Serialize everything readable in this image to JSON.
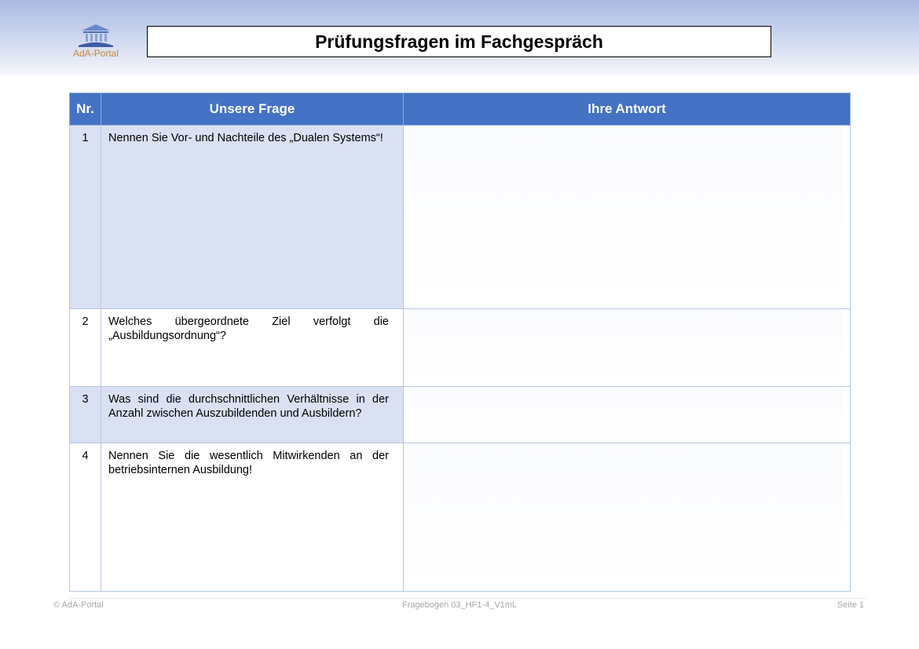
{
  "header": {
    "logo_text": "AdA-Portal",
    "title": "Prüfungsfragen im Fachgespräch"
  },
  "table": {
    "columns": [
      "Nr.",
      "Unsere Frage",
      "Ihre Antwort"
    ],
    "rows": [
      {
        "nr": "1",
        "question": "Nennen Sie Vor- und Nachteile des „Dualen Systems“!",
        "answer": ""
      },
      {
        "nr": "2",
        "question": "Welches übergeordnete Ziel verfolgt die „Ausbildungsordnung“?",
        "answer": ""
      },
      {
        "nr": "3",
        "question": "Was sind die durchschnittlichen Verhältnisse in der Anzahl zwischen Auszubildenden und Ausbildern?",
        "answer": ""
      },
      {
        "nr": "4",
        "question": "Nennen Sie die wesentlich Mitwirkenden an der betriebsinternen Ausbildung!",
        "answer": ""
      }
    ]
  },
  "footer": {
    "left": "© AdA-Portal",
    "center": "Fragebogen 03_HF1-4_V1mL",
    "right": "Seite 1"
  },
  "colors": {
    "header_fill": "#4472c4",
    "row_shade": "#dae1f3",
    "logo_blue": "#4f6fb8",
    "logo_text": "#c9843a"
  }
}
